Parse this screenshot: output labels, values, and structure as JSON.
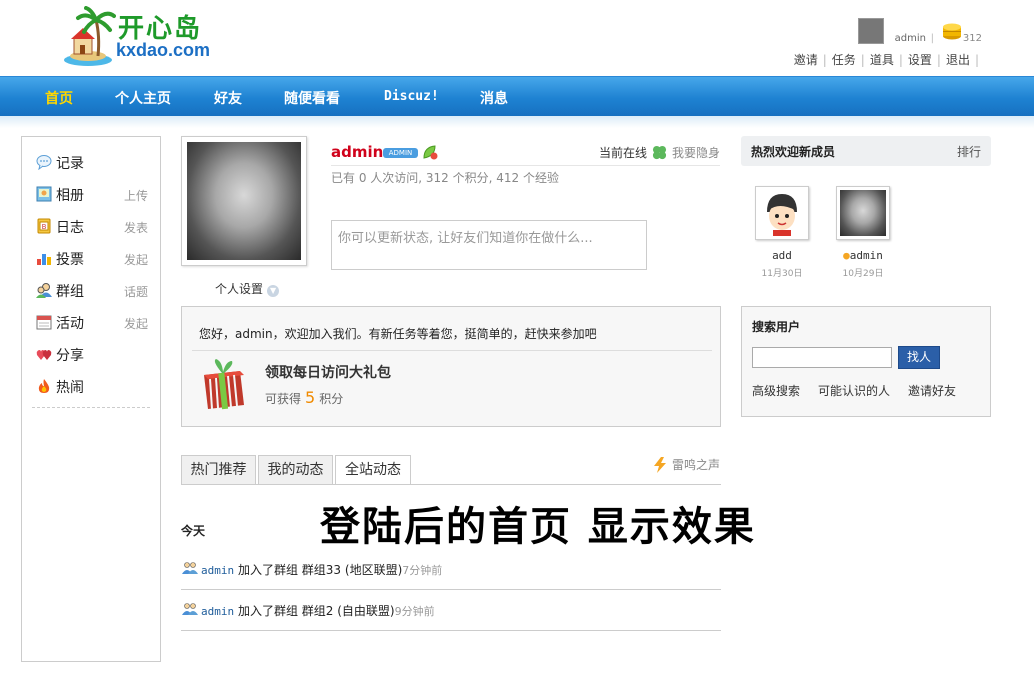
{
  "header": {
    "logo_cn": "开心岛",
    "logo_en": "kxdao.com",
    "username": "admin",
    "credits": "312",
    "links": [
      "邀请",
      "任务",
      "道具",
      "设置",
      "退出"
    ]
  },
  "nav": {
    "items": [
      "首页",
      "个人主页",
      "好友",
      "随便看看",
      "Discuz!",
      "消息"
    ],
    "active_index": 0
  },
  "sidebar": {
    "items": [
      {
        "label": "记录",
        "action": "",
        "icon": "speech-bubble-icon"
      },
      {
        "label": "相册",
        "action": "上传",
        "icon": "photo-album-icon"
      },
      {
        "label": "日志",
        "action": "发表",
        "icon": "blog-icon"
      },
      {
        "label": "投票",
        "action": "发起",
        "icon": "poll-chart-icon"
      },
      {
        "label": "群组",
        "action": "话题",
        "icon": "group-icon"
      },
      {
        "label": "活动",
        "action": "发起",
        "icon": "calendar-icon"
      },
      {
        "label": "分享",
        "action": "",
        "icon": "hearts-icon"
      },
      {
        "label": "热闹",
        "action": "",
        "icon": "fire-icon"
      }
    ]
  },
  "profile": {
    "name": "admin",
    "badge": "ADMIN",
    "online_status": "当前在线",
    "hide_link": "我要隐身",
    "stats": "已有 0 人次访问, 312 个积分, 412 个经验",
    "status_placeholder": "你可以更新状态, 让好友们知道你在做什么...",
    "settings_label": "个人设置"
  },
  "welcome": {
    "text": "您好，admin，欢迎加入我们。有新任务等着您，挺简单的，赶快来参加吧",
    "gift_title": "领取每日访问大礼包",
    "gift_prefix": "可获得",
    "gift_amount": "5",
    "gift_suffix": "积分"
  },
  "feed": {
    "tabs": [
      "热门推荐",
      "我的动态",
      "全站动态"
    ],
    "active_tab": 2,
    "thunder_link": "雷鸣之声",
    "today_label": "今天",
    "overlay_caption": "登陆后的首页 显示效果",
    "rows": [
      {
        "user": "admin",
        "action": "加入了群组",
        "target": "群组33 (地区联盟)",
        "time": "7分钟前"
      },
      {
        "user": "admin",
        "action": "加入了群组",
        "target": "群组2 (自由联盟)",
        "time": "9分钟前"
      }
    ]
  },
  "new_members": {
    "title": "热烈欢迎新成员",
    "rank_link": "排行",
    "members": [
      {
        "name": "add",
        "date": "11月30日",
        "online": false
      },
      {
        "name": "admin",
        "date": "10月29日",
        "online": true
      }
    ]
  },
  "search_users": {
    "title": "搜索用户",
    "input_value": "",
    "button_label": "找人",
    "links": [
      "高级搜索",
      "可能认识的人",
      "邀请好友"
    ]
  }
}
